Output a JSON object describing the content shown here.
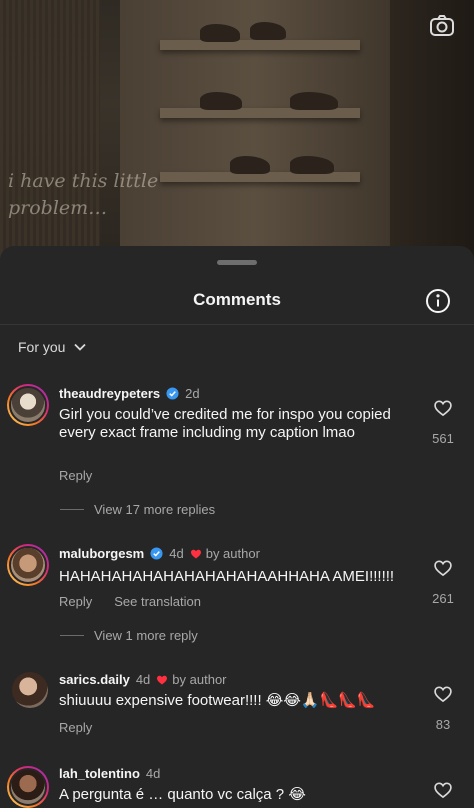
{
  "video": {
    "caption": "i have this little problem…",
    "camera_icon": "camera-icon"
  },
  "sheet": {
    "title": "Comments",
    "filter_label": "For you"
  },
  "comments": [
    {
      "username": "theaudreypeters",
      "verified": true,
      "time": "2d",
      "text": "Girl you could’ve credited me for inspo you copied every exact frame including my caption lmao",
      "reply_label": "Reply",
      "likes": "561",
      "view_replies": "View 17 more replies"
    },
    {
      "username": "maluborgesm",
      "verified": true,
      "time": "4d",
      "by_author": "by author",
      "text": "HAHAHAHAHAHAHAHAHAHAAHHAHA AMEI!!!!!!",
      "reply_label": "Reply",
      "translate_label": "See translation",
      "likes": "261",
      "view_replies": "View 1 more reply"
    },
    {
      "username": "sarics.daily",
      "verified": false,
      "time": "4d",
      "by_author": "by author",
      "text": "shiuuuu expensive footwear!!!! 😂😂🙏🏻👠👠👠",
      "reply_label": "Reply",
      "likes": "83"
    },
    {
      "username": "lah_tolentino",
      "verified": false,
      "time": "4d",
      "text": "A pergunta é … quanto vc calça ? 😂"
    }
  ],
  "colors": {
    "sheet_bg": "#262626",
    "verified_blue": "#3897f0",
    "author_heart": "#ff3040",
    "secondary_text": "#a8a8a8"
  }
}
